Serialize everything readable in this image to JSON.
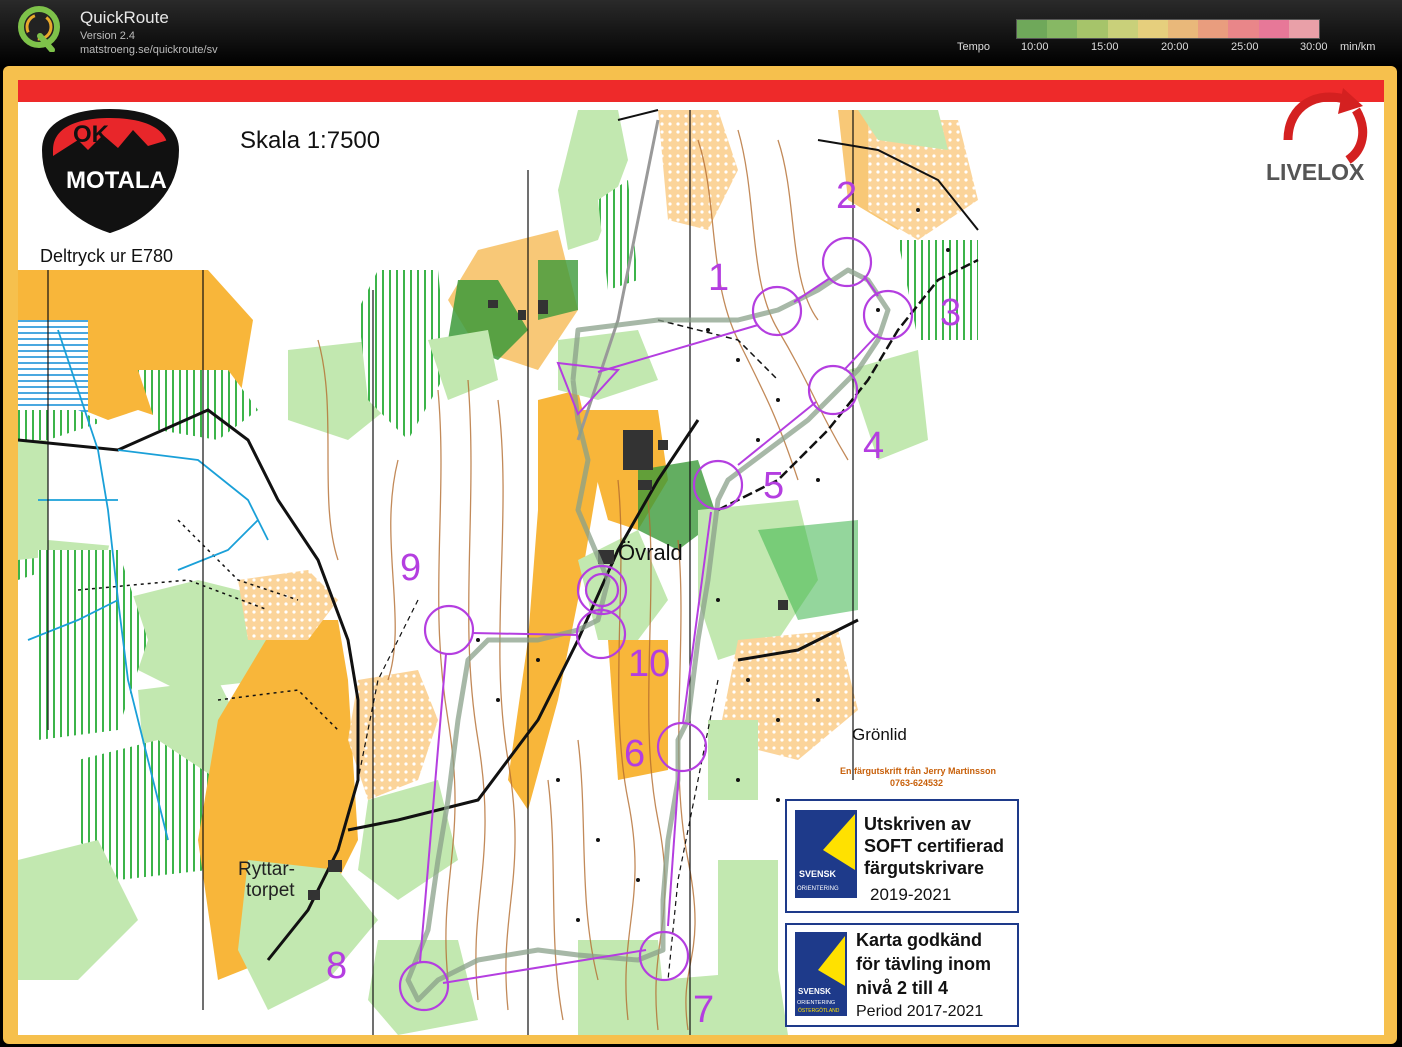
{
  "app": {
    "title": "QuickRoute",
    "version": "Version 2.4",
    "url": "matstroeng.se/quickroute/sv"
  },
  "tempo": {
    "label": "Tempo",
    "ticks": [
      "10:00",
      "15:00",
      "20:00",
      "25:00",
      "30:00"
    ],
    "unit": "min/km",
    "gradient_colors": [
      "#6fa85a",
      "#87b864",
      "#a6c46a",
      "#c9d07a",
      "#e6cf7d",
      "#e9b87a",
      "#e99d7e",
      "#e98689",
      "#e77898",
      "#e9a0a8"
    ]
  },
  "map": {
    "club_logo": "OK MOTALA",
    "scale": "Skala 1:7500",
    "print_note": "Deltryck ur E780",
    "brand": "LIVELOX",
    "place_names": {
      "ovrald": "Övrald",
      "gronlid": "Grönlid",
      "ryttartorpet_1": "Ryttar-",
      "ryttartorpet_2": "torpet"
    },
    "credit": {
      "line1": "En färgutskrift från Jerry Martinsson",
      "line2": "0763-624532"
    },
    "badge1": {
      "org": "SVENSK",
      "org2": "ORIENTERING",
      "lines": [
        "Utskriven av",
        "SOFT certifierad",
        "färgutskrivare"
      ],
      "years": "2019-2021"
    },
    "badge2": {
      "org": "SVENSK",
      "org2": "ORIENTERING",
      "org3": "ÖSTERGÖTLAND",
      "lines": [
        "Karta godkänd",
        "för tävling inom",
        "nivå 2 till 4"
      ],
      "years": "Period 2017-2021"
    },
    "controls": [
      {
        "number": "1"
      },
      {
        "number": "2"
      },
      {
        "number": "3"
      },
      {
        "number": "4"
      },
      {
        "number": "5"
      },
      {
        "number": "6"
      },
      {
        "number": "7"
      },
      {
        "number": "8"
      },
      {
        "number": "9"
      },
      {
        "number": "10"
      }
    ],
    "course_color": "#b43ee0",
    "route_color": "#8aa08a"
  }
}
